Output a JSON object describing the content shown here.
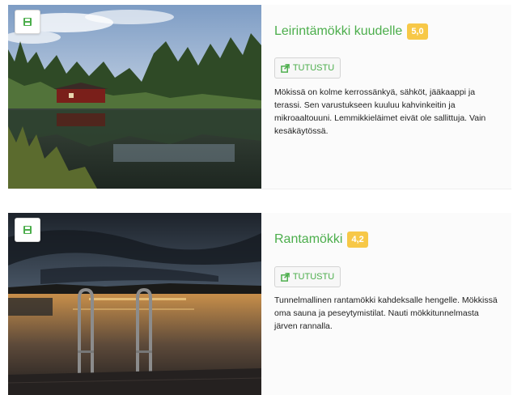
{
  "colors": {
    "accent_green": "#4cae4c",
    "rating_badge": "#f7c847"
  },
  "listings": [
    {
      "title": "Leirintämökki kuudelle",
      "rating": "5,0",
      "button_label": "TUTUSTU",
      "description": "Mökissä on kolme kerrossänkyä, sähköt, jääkaappi ja terassi. Sen varustukseen kuuluu kahvinkeitin ja mikroaaltouuni. Lemmikkieläimet eivät ole sallittuja. Vain kesäkäytössä.",
      "save_icon": "save-icon",
      "button_icon": "external-link-icon"
    },
    {
      "title": "Rantamökki",
      "rating": "4,2",
      "button_label": "TUTUSTU",
      "description": "Tunnelmallinen rantamökki kahdeksalle hengelle. Mökkissä oma sauna ja peseytymistilat. Nauti mökkitunnelmasta järven rannalla.",
      "save_icon": "save-icon",
      "button_icon": "external-link-icon"
    }
  ]
}
